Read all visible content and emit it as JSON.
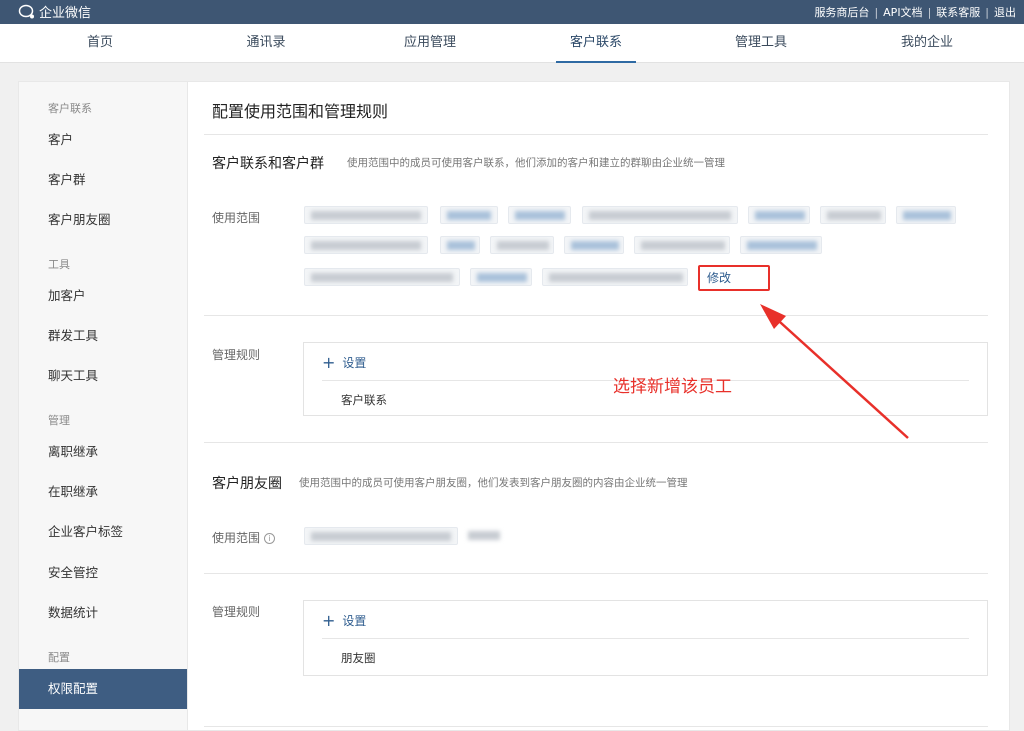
{
  "topbar": {
    "brand": "企业微信",
    "links": [
      "服务商后台",
      "API文档",
      "联系客服",
      "退出"
    ]
  },
  "nav": {
    "items": [
      "首页",
      "通讯录",
      "应用管理",
      "客户联系",
      "管理工具",
      "我的企业"
    ],
    "active": "客户联系"
  },
  "sidebar": {
    "groups": [
      "客户联系",
      "工具",
      "管理",
      "配置"
    ],
    "items": [
      "客户",
      "客户群",
      "客户朋友圈",
      "加客户",
      "群发工具",
      "聊天工具",
      "离职继承",
      "在职继承",
      "企业客户标签",
      "安全管控",
      "数据统计",
      "权限配置"
    ],
    "active": "权限配置"
  },
  "main": {
    "title": "配置使用范围和管理规则",
    "section1": {
      "title": "客户联系和客户群",
      "desc": "使用范围中的成员可使用客户联系，他们添加的客户和建立的群聊由企业统一管理",
      "scope_label": "使用范围",
      "edit_label": "修改",
      "rules_label": "管理规则",
      "add_label": "设置",
      "rule_item": "客户联系"
    },
    "section2": {
      "title": "客户朋友圈",
      "desc": "使用范围中的成员可使用客户朋友圈，他们发表到客户朋友圈的内容由企业统一管理",
      "scope_label": "使用范围",
      "info_icon": "i",
      "rules_label": "管理规则",
      "add_label": "设置",
      "rule_item": "朋友圈"
    }
  },
  "annotation": {
    "text": "选择新增该员工",
    "color": "#e8302a"
  },
  "colors": {
    "topbar": "#3e5673",
    "sidebar_active": "#3e5d82",
    "link": "#2f5d8f",
    "annotation": "#e8302a"
  }
}
